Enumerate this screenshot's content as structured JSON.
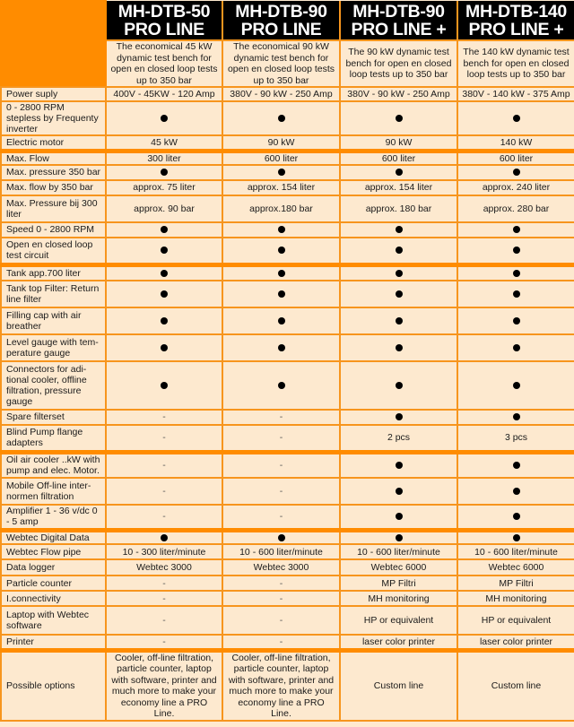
{
  "theme": {
    "accent": "#ff8c00",
    "grid": "#f7951d",
    "cell_bg": "#fde9cf",
    "header_bg": "#000000"
  },
  "models": [
    {
      "line1": "MH-DTB-50",
      "line2": "PRO LINE",
      "description": "The economical 45 kW dynamic test bench for open en closed loop tests up to 350 bar"
    },
    {
      "line1": "MH-DTB-90",
      "line2": "PRO LINE",
      "description": "The economical 90 kW dynamic test bench for open en closed loop tests up to 350 bar"
    },
    {
      "line1": "MH-DTB-90",
      "line2": "PRO LINE +",
      "description": "The 90 kW dynamic test bench for open en closed loop tests up to 350 bar"
    },
    {
      "line1": "MH-DTB-140",
      "line2": "PRO LINE +",
      "description": "The 140 kW dynamic test bench for open en closed loop tests up to 350 bar"
    }
  ],
  "rows": [
    {
      "label": "Power suply",
      "values": [
        "400V - 45KW - 120 Amp",
        "380V - 90 kW - 250 Amp",
        "380V - 90 kW - 250 Amp",
        "380V - 140 kW - 375 Amp"
      ]
    },
    {
      "label": "0 - 2800 RPM stepless by Frequenty inverter",
      "values": [
        "●",
        "●",
        "●",
        "●"
      ]
    },
    {
      "label": "Electric motor",
      "values": [
        "45 kW",
        "90 kW",
        "90 kW",
        "140 kW"
      ]
    },
    {
      "label": "Max. Flow",
      "values": [
        "300 liter",
        "600 liter",
        "600 liter",
        "600 liter"
      ],
      "group_start": true
    },
    {
      "label": "Max. pressure 350 bar",
      "values": [
        "●",
        "●",
        "●",
        "●"
      ]
    },
    {
      "label": "Max. flow by 350 bar",
      "values": [
        "approx. 75 liter",
        "approx. 154 liter",
        "approx. 154 liter",
        "approx. 240 liter"
      ]
    },
    {
      "label": "Max. Pressure bij 300 liter",
      "values": [
        "approx. 90 bar",
        "approx.180 bar",
        "approx. 180 bar",
        "approx. 280 bar"
      ]
    },
    {
      "label": "Speed 0 - 2800 RPM",
      "values": [
        "●",
        "●",
        "●",
        "●"
      ]
    },
    {
      "label": "Open en closed loop test circuit",
      "values": [
        "●",
        "●",
        "●",
        "●"
      ]
    },
    {
      "label": "Tank app.700 liter",
      "values": [
        "●",
        "●",
        "●",
        "●"
      ],
      "group_start": true
    },
    {
      "label": "Tank top Filter: Return line filter",
      "values": [
        "●",
        "●",
        "●",
        "●"
      ]
    },
    {
      "label": "Filling cap with air breather",
      "values": [
        "●",
        "●",
        "●",
        "●"
      ]
    },
    {
      "label": "Level gauge with tem-perature gauge",
      "values": [
        "●",
        "●",
        "●",
        "●"
      ]
    },
    {
      "label": "Connectors for adi-tional cooler, offline filtration, pressure gauge",
      "values": [
        "●",
        "●",
        "●",
        "●"
      ]
    },
    {
      "label": "Spare filterset",
      "values": [
        "-",
        "-",
        "●",
        "●"
      ]
    },
    {
      "label": "Blind Pump flange adapters",
      "values": [
        "-",
        "-",
        "2 pcs",
        "3 pcs"
      ]
    },
    {
      "label": "Oil air cooler ..kW with pump and elec. Motor.",
      "values": [
        "-",
        "-",
        "●",
        "●"
      ],
      "group_start": true
    },
    {
      "label": "Mobile Off-line inter-normen filtration",
      "values": [
        "-",
        "-",
        "●",
        "●"
      ]
    },
    {
      "label": "Amplifier 1 - 36 v/dc 0 - 5 amp",
      "values": [
        "-",
        "-",
        "●",
        "●"
      ]
    },
    {
      "label": "Webtec Digital Data",
      "values": [
        "●",
        "●",
        "●",
        "●"
      ],
      "group_start": true
    },
    {
      "label": "Webtec Flow pipe",
      "values": [
        "10 - 300 liter/minute",
        "10 - 600 liter/minute",
        "10 - 600 liter/minute",
        "10 - 600 liter/minute"
      ]
    },
    {
      "label": "Data logger",
      "values": [
        "Webtec 3000",
        "Webtec 3000",
        "Webtec 6000",
        "Webtec 6000"
      ]
    },
    {
      "label": "Particle counter",
      "values": [
        "-",
        "-",
        "MP Filtri",
        "MP Filtri"
      ]
    },
    {
      "label": "I.connectivity",
      "values": [
        "-",
        "-",
        "MH monitoring",
        "MH monitoring"
      ]
    },
    {
      "label": "Laptop with Webtec software",
      "values": [
        "-",
        "-",
        "HP or equivalent",
        "HP or equivalent"
      ]
    },
    {
      "label": "Printer",
      "values": [
        "-",
        "-",
        "laser color printer",
        "laser color printer"
      ]
    },
    {
      "label": "Possible options",
      "values": [
        "Cooler, off-line filtration, particle counter, laptop with software, printer and much more to make your economy line a PRO Line.",
        "Cooler, off-line filtration, particle counter, laptop with software, printer and much more to make your economy line a PRO Line.",
        "Custom line",
        "Custom line"
      ],
      "group_start": true
    }
  ],
  "row_heights": null
}
